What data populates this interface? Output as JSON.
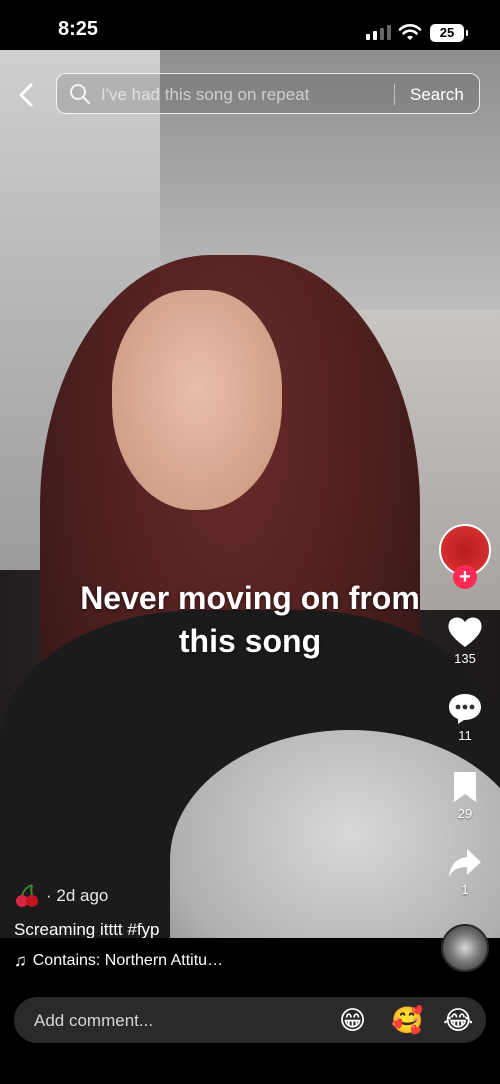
{
  "status": {
    "time": "8:25",
    "battery": "25"
  },
  "search": {
    "query": "I've had this song on repeat",
    "button": "Search"
  },
  "video": {
    "caption_line1": "Never moving on from",
    "caption_line2": "this song"
  },
  "rail": {
    "likes": "135",
    "comments": "11",
    "saves": "29",
    "shares": "1",
    "follow_symbol": "+"
  },
  "post": {
    "age": "· 2d ago",
    "description": "Screaming itttt #fyp",
    "music": "Contains: Northern Attitu…",
    "music_icon": "♫"
  },
  "comment": {
    "placeholder": "Add comment...",
    "emojis": [
      "😁",
      "🥰",
      "😂"
    ]
  },
  "colors": {
    "follow": "#fe2c55",
    "background": "#000000"
  }
}
